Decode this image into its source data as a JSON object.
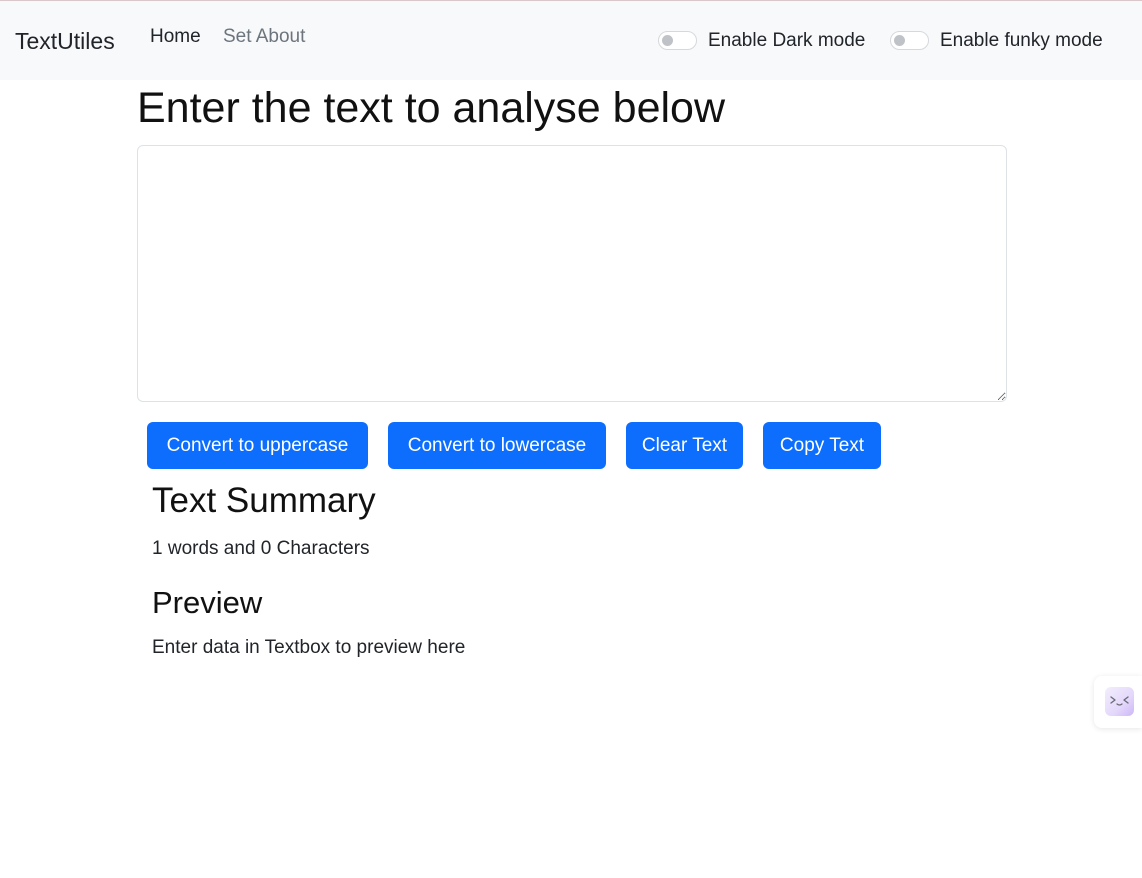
{
  "navbar": {
    "brand": "TextUtiles",
    "links": [
      {
        "label": "Home"
      },
      {
        "label": "Set About"
      }
    ],
    "toggles": [
      {
        "label": "Enable Dark mode",
        "checked": false
      },
      {
        "label": "Enable funky mode",
        "checked": false
      }
    ]
  },
  "main": {
    "heading": "Enter the text to analyse below",
    "textarea": {
      "value": ""
    },
    "buttons": [
      {
        "label": "Convert to uppercase"
      },
      {
        "label": "Convert to lowercase"
      },
      {
        "label": "Clear Text"
      },
      {
        "label": "Copy Text"
      }
    ],
    "summary": {
      "title": "Text Summary",
      "text": "1 words and 0 Characters"
    },
    "preview": {
      "title": "Preview",
      "text": "Enter data in Textbox to preview here"
    }
  },
  "floating_widget": {
    "icon": "assistant-face-icon"
  },
  "colors": {
    "primary": "#0d6efd",
    "navbar_bg": "#f8f9fa",
    "muted": "#6c757d"
  }
}
